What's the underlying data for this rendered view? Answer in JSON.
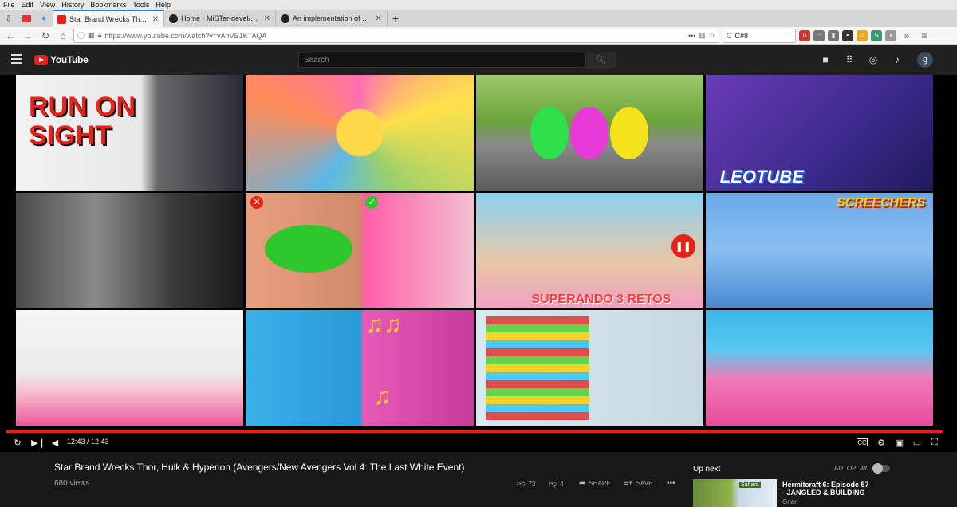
{
  "browser": {
    "menu": [
      "File",
      "Edit",
      "View",
      "History",
      "Bookmarks",
      "Tools",
      "Help"
    ],
    "tabs": [
      {
        "label": "Star Brand Wrecks Thor, Hulk &",
        "active": true
      },
      {
        "label": "Home · MiSTer-devel/Main_Mi",
        "active": false
      },
      {
        "label": "An implementation of a simple",
        "active": false
      }
    ],
    "url": "https://www.youtube.com/watch?v=vAnVB1KTAQA",
    "search_value": "C#8"
  },
  "youtube": {
    "logo_text": "YouTube",
    "search_placeholder": "Search",
    "avatar_letter": "g"
  },
  "thumbnails": [
    {
      "text": "RUN ON SIGHT"
    },
    {
      "text": ""
    },
    {
      "text": ""
    },
    {
      "text": "LEOTUBE"
    },
    {
      "text": ""
    },
    {
      "text": ""
    },
    {
      "text": "SUPERANDO 3 RETOS"
    },
    {
      "text": "SCREECHERS"
    },
    {
      "text": ""
    },
    {
      "text": ""
    },
    {
      "text": ""
    },
    {
      "text": ""
    }
  ],
  "player": {
    "time": "12:43 / 12:43",
    "progress": 1.0
  },
  "video": {
    "title": "Star Brand Wrecks Thor, Hulk & Hyperion (Avengers/New Avengers Vol 4: The Last White Event)",
    "views": "680 views",
    "likes": "73",
    "dislikes": "4",
    "share": "SHARE",
    "save": "SAVE"
  },
  "sidebar": {
    "up_next": "Up next",
    "autoplay": "AUTOPLAY",
    "next_title": "Hermitcraft 6: Episode 57 - JANGLED & BUILDING",
    "next_channel": "Grian",
    "next_badge": "Sahara"
  }
}
